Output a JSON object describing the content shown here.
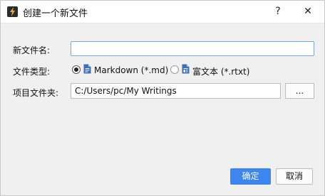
{
  "window": {
    "title": "创建一个新文件",
    "help_label": "?",
    "close_label": "✕"
  },
  "form": {
    "name_label": "新文件名:",
    "name_value": "",
    "type_label": "文件类型:",
    "type_options": [
      {
        "label": "Markdown (*.md)",
        "selected": true
      },
      {
        "label": "富文本 (*.rtxt)",
        "selected": false
      }
    ],
    "folder_label": "项目文件夹:",
    "folder_value": "C:/Users/pc/My Writings",
    "browse_label": "..."
  },
  "buttons": {
    "ok_label": "确定",
    "cancel_label": "取消"
  },
  "colors": {
    "accent": "#3d85f0",
    "input_focus_border": "#7aa7d9",
    "file_icon": "#3b6fb6"
  },
  "icons": [
    "app-icon",
    "help-icon",
    "close-icon",
    "markdown-file-icon",
    "rich-text-file-icon"
  ]
}
